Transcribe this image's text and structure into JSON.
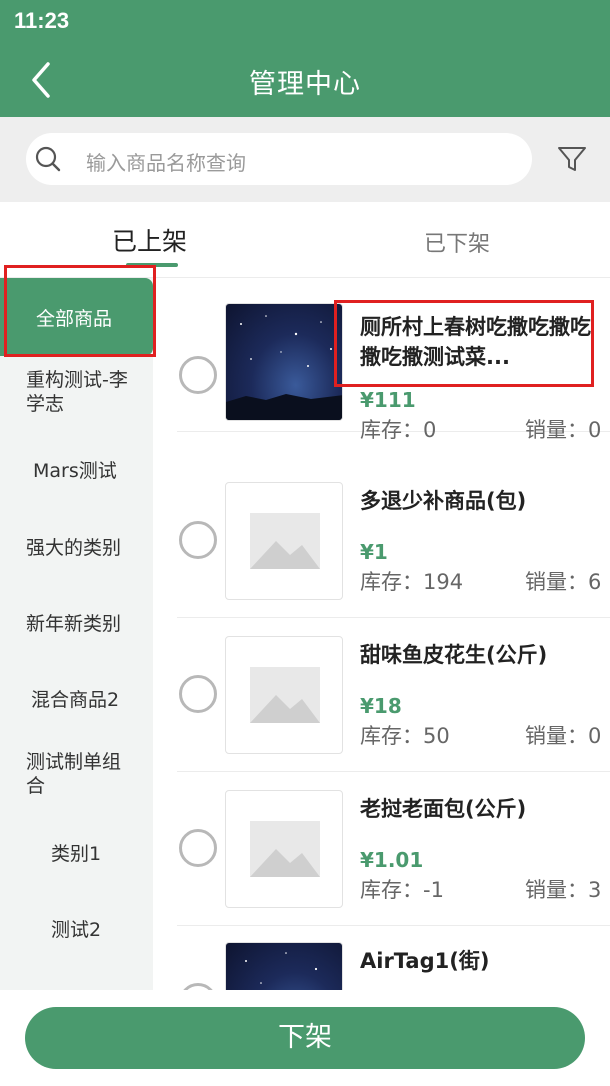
{
  "status_bar": {
    "time": "11:23"
  },
  "header": {
    "title": "管理中心",
    "back_icon": "chevron-left-icon"
  },
  "search": {
    "placeholder": "输入商品名称查询",
    "icon": "search-icon",
    "filter_icon": "filter-icon"
  },
  "tabs": [
    {
      "label": "已上架",
      "active": true
    },
    {
      "label": "已下架",
      "active": false
    }
  ],
  "categories": [
    {
      "label": "全部商品",
      "active": true
    },
    {
      "label": "重构测试-李学志"
    },
    {
      "label": "Mars测试"
    },
    {
      "label": "强大的类别"
    },
    {
      "label": "新年新类别"
    },
    {
      "label": "混合商品2"
    },
    {
      "label": "测试制单组合"
    },
    {
      "label": "类别1"
    },
    {
      "label": "测试2"
    }
  ],
  "products": [
    {
      "name": "厕所村上春树吃撒吃撒吃撒吃撒测试菜...",
      "price": "¥111",
      "stock": "库存：0",
      "sales": "销量：0",
      "image": "night-sky-photo"
    },
    {
      "name": "多退少补商品(包)",
      "price": "¥1",
      "stock": "库存：194",
      "sales": "销量：6",
      "image": "image-placeholder-icon"
    },
    {
      "name": "甜味鱼皮花生(公斤)",
      "price": "¥18",
      "stock": "库存：50",
      "sales": "销量：0",
      "image": "image-placeholder-icon"
    },
    {
      "name": "老挝老面包(公斤)",
      "price": "¥1.01",
      "stock": "库存：-1",
      "sales": "销量：3",
      "image": "image-placeholder-icon"
    },
    {
      "name": "AirTag1(街)",
      "image": "night-sky-photo"
    }
  ],
  "bottom": {
    "button_label": "下架"
  },
  "colors": {
    "primary": "#4a9a6e",
    "highlight": "#e02020",
    "sidebar_bg": "#f2f4f3"
  }
}
